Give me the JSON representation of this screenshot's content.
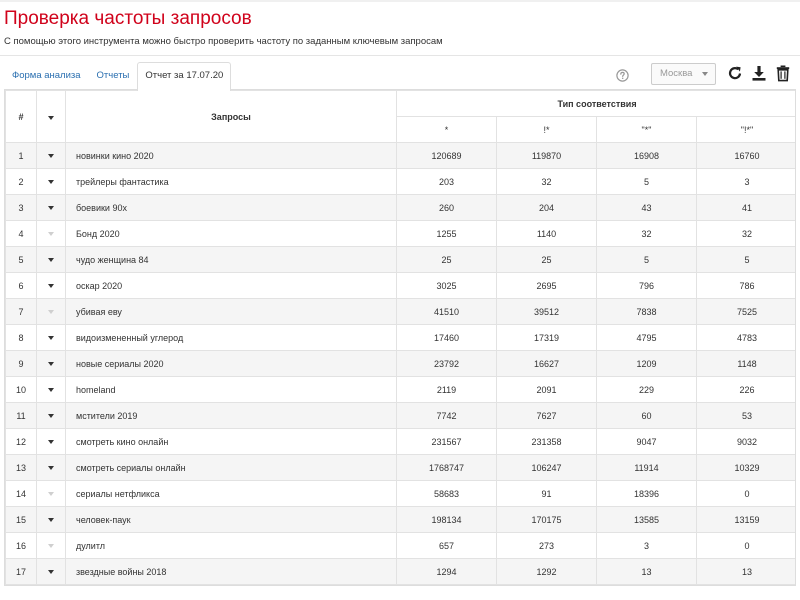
{
  "page": {
    "title": "Проверка частоты запросов",
    "subtitle": "С помощью этого инструмента можно быстро проверить частоту по заданным ключевым запросам"
  },
  "tabs": [
    {
      "label": "Форма анализа",
      "active": false
    },
    {
      "label": "Отчеты",
      "active": false
    },
    {
      "label": "Отчет за 17.07.20",
      "active": true
    }
  ],
  "toolbar": {
    "help_icon": "question-circle-icon",
    "region": "Москва",
    "refresh_icon": "refresh-icon",
    "download_icon": "download-icon",
    "delete_icon": "trash-icon"
  },
  "table": {
    "col_num": "#",
    "col_query": "Запросы",
    "group_header": "Тип соответствия",
    "match_types": [
      "*",
      "!*",
      "\"*\"",
      "\"!*\""
    ],
    "rows": [
      {
        "n": "1",
        "query": "новинки кино 2020",
        "dim": false,
        "v": [
          "120689",
          "119870",
          "16908",
          "16760"
        ]
      },
      {
        "n": "2",
        "query": "трейлеры фантастика",
        "dim": false,
        "v": [
          "203",
          "32",
          "5",
          "3"
        ]
      },
      {
        "n": "3",
        "query": "боевики 90х",
        "dim": false,
        "v": [
          "260",
          "204",
          "43",
          "41"
        ]
      },
      {
        "n": "4",
        "query": "Бонд 2020",
        "dim": true,
        "v": [
          "1255",
          "1140",
          "32",
          "32"
        ]
      },
      {
        "n": "5",
        "query": "чудо женщина 84",
        "dim": false,
        "v": [
          "25",
          "25",
          "5",
          "5"
        ]
      },
      {
        "n": "6",
        "query": "оскар 2020",
        "dim": false,
        "v": [
          "3025",
          "2695",
          "796",
          "786"
        ]
      },
      {
        "n": "7",
        "query": "убивая еву",
        "dim": true,
        "v": [
          "41510",
          "39512",
          "7838",
          "7525"
        ]
      },
      {
        "n": "8",
        "query": "видоизмененный углерод",
        "dim": false,
        "v": [
          "17460",
          "17319",
          "4795",
          "4783"
        ]
      },
      {
        "n": "9",
        "query": "новые сериалы 2020",
        "dim": false,
        "v": [
          "23792",
          "16627",
          "1209",
          "1148"
        ]
      },
      {
        "n": "10",
        "query": "homeland",
        "dim": false,
        "v": [
          "2119",
          "2091",
          "229",
          "226"
        ]
      },
      {
        "n": "11",
        "query": "мстители 2019",
        "dim": false,
        "v": [
          "7742",
          "7627",
          "60",
          "53"
        ]
      },
      {
        "n": "12",
        "query": "смотреть кино онлайн",
        "dim": false,
        "v": [
          "231567",
          "231358",
          "9047",
          "9032"
        ]
      },
      {
        "n": "13",
        "query": "смотреть сериалы онлайн",
        "dim": false,
        "v": [
          "1768747",
          "106247",
          "11914",
          "10329"
        ]
      },
      {
        "n": "14",
        "query": "сериалы нетфликса",
        "dim": true,
        "v": [
          "58683",
          "91",
          "18396",
          "0"
        ]
      },
      {
        "n": "15",
        "query": "человек-паук",
        "dim": false,
        "v": [
          "198134",
          "170175",
          "13585",
          "13159"
        ]
      },
      {
        "n": "16",
        "query": "дулитл",
        "dim": true,
        "v": [
          "657",
          "273",
          "3",
          "0"
        ]
      },
      {
        "n": "17",
        "query": "звездные войны 2018",
        "dim": false,
        "v": [
          "1294",
          "1292",
          "13",
          "13"
        ]
      }
    ]
  }
}
